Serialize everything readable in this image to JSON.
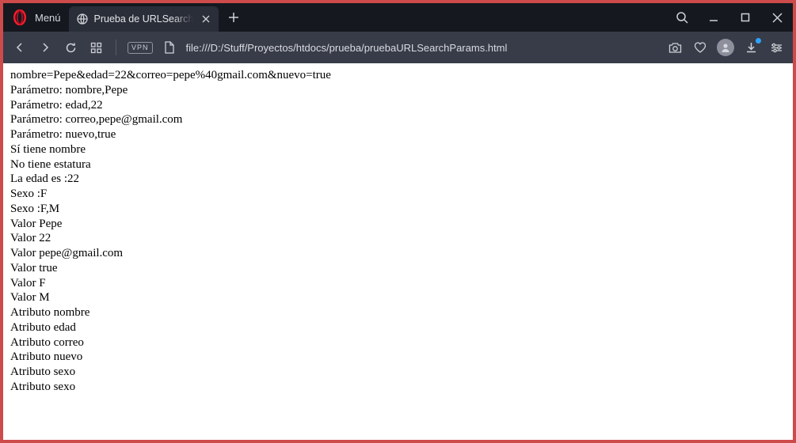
{
  "titlebar": {
    "menu_label": "Menú",
    "active_tab_title": "Prueba de URLSearchParams"
  },
  "addressbar": {
    "vpn_label": "VPN",
    "url": "file:///D:/Stuff/Proyectos/htdocs/prueba/pruebaURLSearchParams.html"
  },
  "page": {
    "lines": [
      "nombre=Pepe&edad=22&correo=pepe%40gmail.com&nuevo=true",
      "Parámetro: nombre,Pepe",
      "Parámetro: edad,22",
      "Parámetro: correo,pepe@gmail.com",
      "Parámetro: nuevo,true",
      "Sí tiene nombre",
      "No tiene estatura",
      "La edad es :22",
      "Sexo :F",
      "Sexo :F,M",
      "Valor Pepe",
      "Valor 22",
      "Valor pepe@gmail.com",
      "Valor true",
      "Valor F",
      "Valor M",
      "Atributo nombre",
      "Atributo edad",
      "Atributo correo",
      "Atributo nuevo",
      "Atributo sexo",
      "Atributo sexo"
    ]
  }
}
